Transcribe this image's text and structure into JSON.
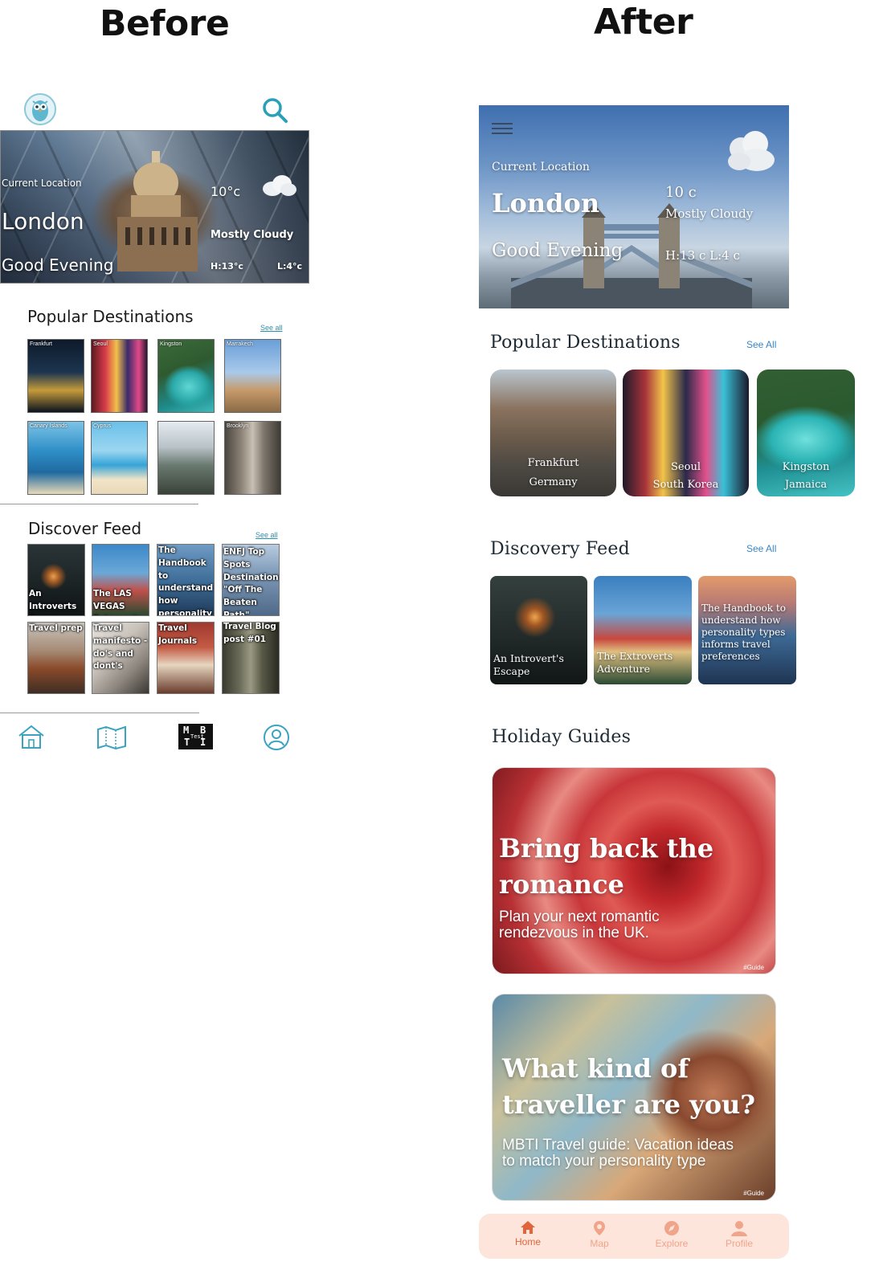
{
  "labels": {
    "before": "Before",
    "after": "After"
  },
  "before": {
    "hero": {
      "location_label": "Current Location",
      "city": "London",
      "greeting": "Good Evening",
      "temp": "10°c",
      "condition": "Mostly Cloudy",
      "high": "H:13°c",
      "low": "L:4°c"
    },
    "popular": {
      "title": "Popular Destinations",
      "see_all": "See all",
      "items": [
        "Frankfurt",
        "Seoul",
        "Kingston",
        "Marrakech",
        "Canary Islands",
        "Cyprus",
        "",
        "Brooklyn"
      ]
    },
    "feed": {
      "title": "Discover Feed",
      "see_all": "See all",
      "items": [
        "An Introverts Escape",
        "The LAS VEGAS Extroverts",
        "The Handbook to understand how personality types informs travel",
        "ENFJ Top Spots Destinations \"Off The Beaten Path\"",
        "Travel prep",
        "Travel manifesto - do's and dont's",
        "Travel Journals",
        "Travel Blog post #01"
      ]
    },
    "nav": {
      "mbti_letters": [
        "M",
        "B",
        "T",
        "I"
      ],
      "mbti_small": "Test"
    }
  },
  "after": {
    "hero": {
      "location_label": "Current Location",
      "city": "London",
      "greeting": "Good Evening",
      "temp": "10   c",
      "condition": "Mostly Cloudy",
      "hilo": "H:13   c L:4   c"
    },
    "popular": {
      "title": "Popular Destinations",
      "see_all": "See All",
      "items": [
        {
          "city": "Frankfurt",
          "country": "Germany"
        },
        {
          "city": "Seoul",
          "country": "South Korea"
        },
        {
          "city": "Kingston",
          "country": "Jamaica"
        }
      ]
    },
    "feed": {
      "title": "Discovery Feed",
      "see_all": "See All",
      "items": [
        "An Introvert's Escape",
        "The Extroverts Adventure",
        "The Handbook to understand how personality types informs travel preferences"
      ]
    },
    "guides": {
      "title": "Holiday Guides",
      "items": [
        {
          "headline": "Bring back the romance",
          "sub": "Plan your next romantic rendezvous in the UK.",
          "tag": "#Guide"
        },
        {
          "headline": "What kind of traveller are you?",
          "sub": "MBTI Travel guide: Vacation ideas to match your personality type",
          "tag": "#Guide"
        }
      ]
    },
    "nav": [
      {
        "label": "Home",
        "icon": "home-icon",
        "active": true
      },
      {
        "label": "Map",
        "icon": "map-pin-icon",
        "active": false
      },
      {
        "label": "Explore",
        "icon": "compass-icon",
        "active": false
      },
      {
        "label": "Profile",
        "icon": "person-icon",
        "active": false
      }
    ],
    "colors": {
      "accent": "#e0653b",
      "nav_bg": "#fde5dc",
      "link": "#3a86c6"
    }
  }
}
